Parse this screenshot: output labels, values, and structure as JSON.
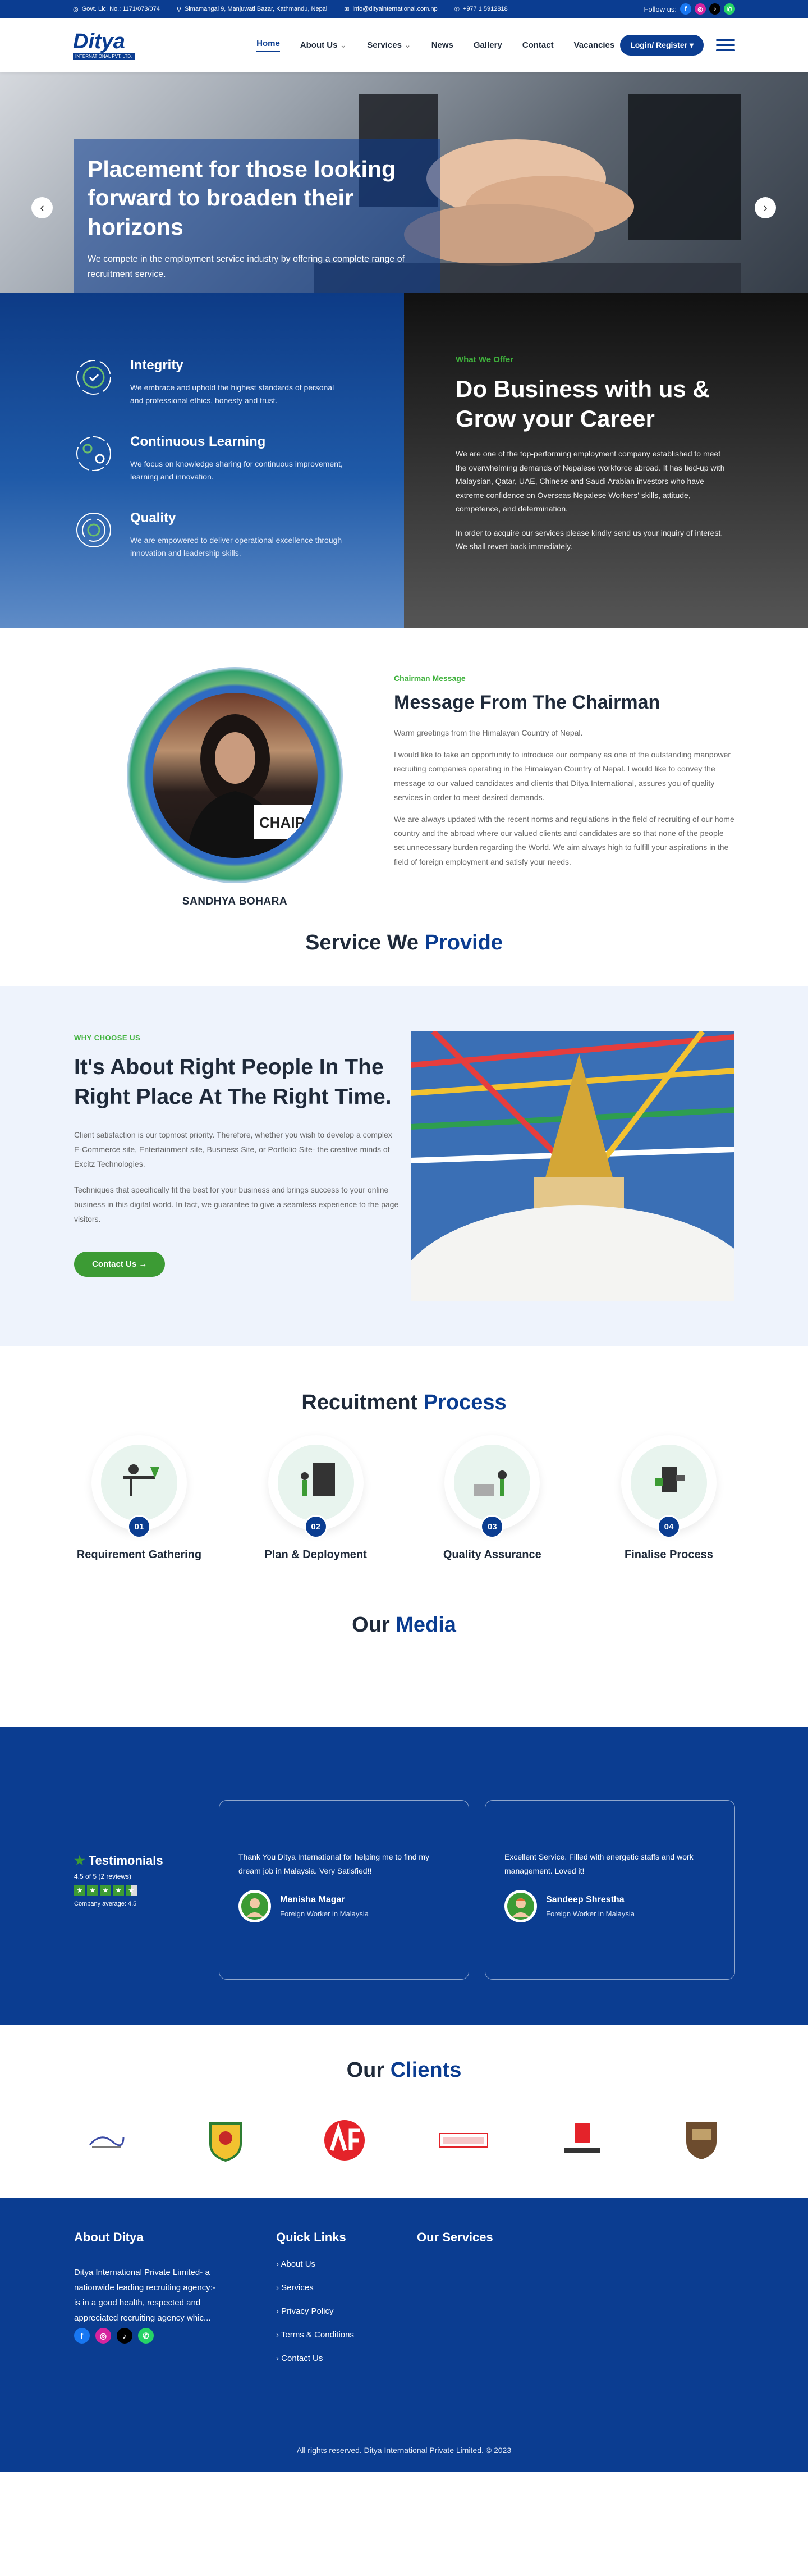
{
  "topbar": {
    "license": "Govt. Lic. No.: 1171/073/074",
    "address": "Simamangal 9, Manjuwati Bazar, Kathmandu, Nepal",
    "email": "info@dityainternational.com.np",
    "phone": "+977 1 5912818",
    "follow": "Follow us:"
  },
  "header": {
    "logo_text": "Ditya",
    "logo_sub": "INTERNATIONAL PVT. LTD.",
    "nav": [
      "Home",
      "About Us",
      "Services",
      "News",
      "Gallery",
      "Contact",
      "Vacancies"
    ],
    "login": "Login/ Register"
  },
  "hero": {
    "title": "Placement for those looking forward to broaden their horizons",
    "text": "We compete in the employment service industry by offering a complete range of recruitment service.",
    "prev": "‹",
    "next": "›"
  },
  "values": [
    {
      "title": "Integrity",
      "text": "We embrace and uphold the highest standards of personal and professional ethics, honesty and trust."
    },
    {
      "title": "Continuous Learning",
      "text": "We focus on knowledge sharing for continuous improvement, learning and innovation."
    },
    {
      "title": "Quality",
      "text": "We are empowered to deliver operational excellence through innovation and leadership skills."
    }
  ],
  "offer": {
    "label": "What We Offer",
    "title": "Do Business with us & Grow your Career",
    "p1": "We are one of the top-performing employment company established to meet the overwhelming demands of Nepalese workforce abroad. It has tied-up with Malaysian, Qatar, UAE, Chinese and Saudi Arabian investors who have extreme confidence on Overseas Nepalese Workers' skills, attitude, competence, and determination.",
    "p2": "In order to acquire our services please kindly send us your inquiry of interest. We shall revert back immediately."
  },
  "chairman": {
    "label": "Chairman Message",
    "title": "Message From The Chairman",
    "p1": "Warm greetings from the Himalayan Country of Nepal.",
    "p2": "I would like to take an opportunity to introduce our company as one of the outstanding manpower recruiting companies operating in the Himalayan Country of Nepal. I would like to convey the message to our valued candidates and clients that Ditya International, assures you of quality services in order to meet desired demands.",
    "p3": "We are always updated with the recent norms and regulations in the field of recruiting of our home country and the abroad where our valued clients and candidates are so that none of the people set unnecessary burden regarding the World. We aim always high to fulfill your aspirations in the field of foreign employment and satisfy your needs.",
    "name": "SANDHYA BOHARA",
    "nameplate": "CHAIR"
  },
  "services": {
    "title_a": "Service We",
    "title_b": "Provide"
  },
  "why": {
    "label": "WHY CHOOSE US",
    "title": "It's About Right People In The Right Place At The Right Time.",
    "p1": "Client satisfaction is our topmost priority. Therefore, whether you wish to develop a complex E-Commerce site, Entertainment site, Business Site, or Portfolio Site- the creative minds of Excitz Technologies.",
    "p2": "Techniques that specifically fit the best for your business and brings success to your online business in this digital world. In fact, we guarantee to give a seamless experience to the page visitors.",
    "button": "Contact Us"
  },
  "process": {
    "title_a": "Recuitment",
    "title_b": "Process",
    "steps": [
      {
        "num": "01",
        "label": "Requirement Gathering"
      },
      {
        "num": "02",
        "label": "Plan & Deployment"
      },
      {
        "num": "03",
        "label": "Quality Assurance"
      },
      {
        "num": "04",
        "label": "Finalise Process"
      }
    ]
  },
  "media": {
    "title_a": "Our",
    "title_b": "Media"
  },
  "testimonials": {
    "heading": "Testimonials",
    "rating": "4.5 of 5 (2 reviews)",
    "average": "Company average: 4.5",
    "items": [
      {
        "text": "Thank You Ditya International for helping me to find my dream job in Malaysia. Very Satisfied!!",
        "name": "Manisha Magar",
        "role": "Foreign Worker in Malaysia"
      },
      {
        "text": "Excellent Service. Filled with energetic staffs and work management. Loved it!",
        "name": "Sandeep Shrestha",
        "role": "Foreign Worker in Malaysia"
      }
    ]
  },
  "clients": {
    "title_a": "Our",
    "title_b": "Clients"
  },
  "footer": {
    "about_title": "About Ditya",
    "about_text": "Ditya International Private Limited- a nationwide leading recruiting agency:- is in a good health, respected and appreciated recruiting agency whic...",
    "links_title": "Quick Links",
    "links": [
      "About Us",
      "Services",
      "Privacy Policy",
      "Terms & Conditions",
      "Contact Us"
    ],
    "services_title": "Our Services",
    "copyright": "All rights reserved. Ditya International Private Limited. © 2023"
  },
  "colors": {
    "primary": "#0b3d91",
    "accent_green": "#3c9b34"
  }
}
